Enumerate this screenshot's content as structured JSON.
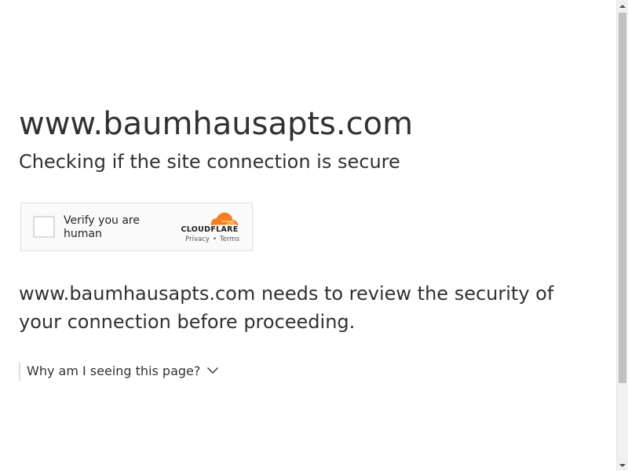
{
  "header": {
    "site": "www.baumhausapts.com",
    "subtitle": "Checking if the site connection is secure"
  },
  "widget": {
    "label": "Verify you are human",
    "brand": "CLOUDFLARE",
    "privacy_link": "Privacy",
    "separator": "•",
    "terms_link": "Terms",
    "logo_color": "#F38020"
  },
  "main": {
    "review_text": "www.baumhausapts.com needs to review the security of your connection before proceeding.",
    "why_label": "Why am I seeing this page?"
  },
  "scrollbar": {
    "up_icon": "scroll-up-arrow",
    "down_icon": "scroll-down-arrow"
  }
}
